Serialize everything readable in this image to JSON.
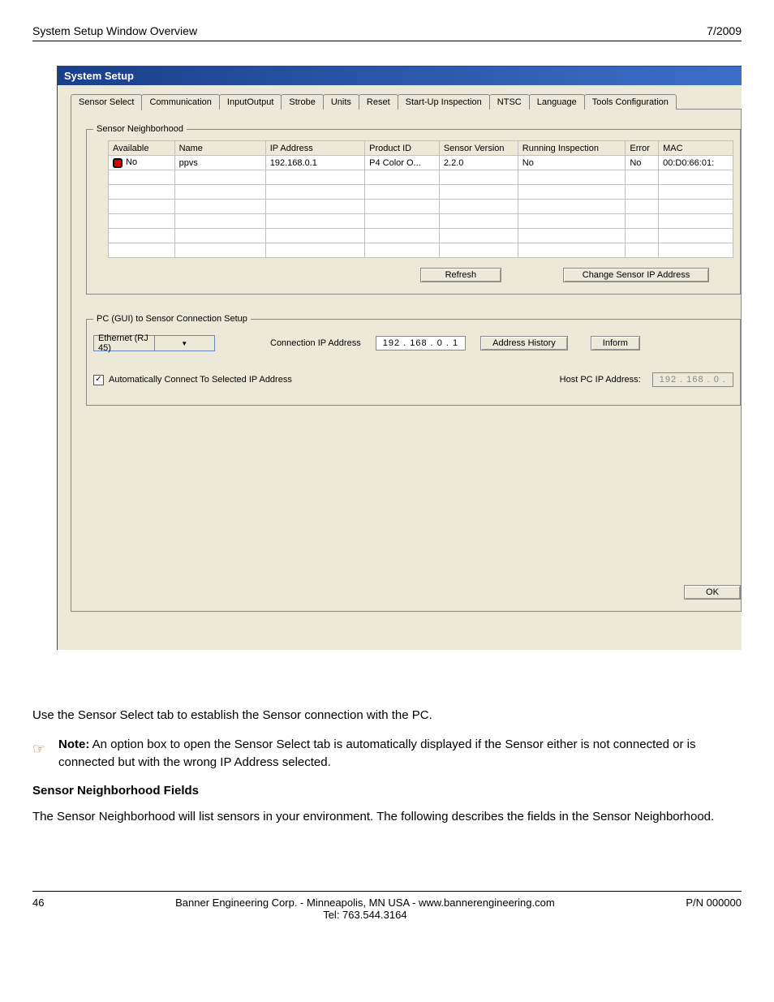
{
  "header": {
    "left": "System Setup Window Overview",
    "right": "7/2009"
  },
  "window": {
    "title": "System Setup",
    "tabs": [
      "Sensor Select",
      "Communication",
      "InputOutput",
      "Strobe",
      "Units",
      "Reset",
      "Start-Up Inspection",
      "NTSC",
      "Language",
      "Tools Configuration"
    ],
    "neighborhood": {
      "legend": "Sensor Neighborhood",
      "columns": [
        "Available",
        "Name",
        "IP Address",
        "Product ID",
        "Sensor Version",
        "Running Inspection",
        "Error",
        "MAC"
      ],
      "row": {
        "available": "No",
        "name": "ppvs",
        "ip": "192.168.0.1",
        "product": "P4 Color O...",
        "version": "2.2.0",
        "running": "No",
        "error": "No",
        "mac": "00:D0:66:01:"
      },
      "refresh_btn": "Refresh",
      "change_ip_btn": "Change Sensor IP Address"
    },
    "connection": {
      "legend": "PC (GUI) to Sensor Connection Setup",
      "type": "Ethernet (RJ 45)",
      "ip_label": "Connection IP Address",
      "ip_value": "192 . 168 .   0  .   1",
      "history_btn": "Address History",
      "inform_btn": "Inform",
      "auto_connect_label": "Automatically Connect To Selected IP Address",
      "host_label": "Host PC IP Address:",
      "host_value": "192  .  168  .   0   ."
    },
    "ok_btn": "OK"
  },
  "body": {
    "intro": "Use the Sensor Select tab  to establish the Sensor connection with the PC.",
    "note_label": "Note:",
    "note_text": "  An option box to open the Sensor Select tab is automatically displayed if the Sensor either is not connected or is connected but with the wrong IP Address selected.",
    "section_head": "Sensor Neighborhood Fields",
    "section_body": "The Sensor Neighborhood will list sensors in your environment. The following describes the fields in the Sensor Neighborhood."
  },
  "footer": {
    "page_num": "46",
    "center1": "Banner Engineering Corp. - Minneapolis, MN USA - www.bannerengineering.com",
    "center2": "Tel: 763.544.3164",
    "pn": "P/N 000000"
  }
}
